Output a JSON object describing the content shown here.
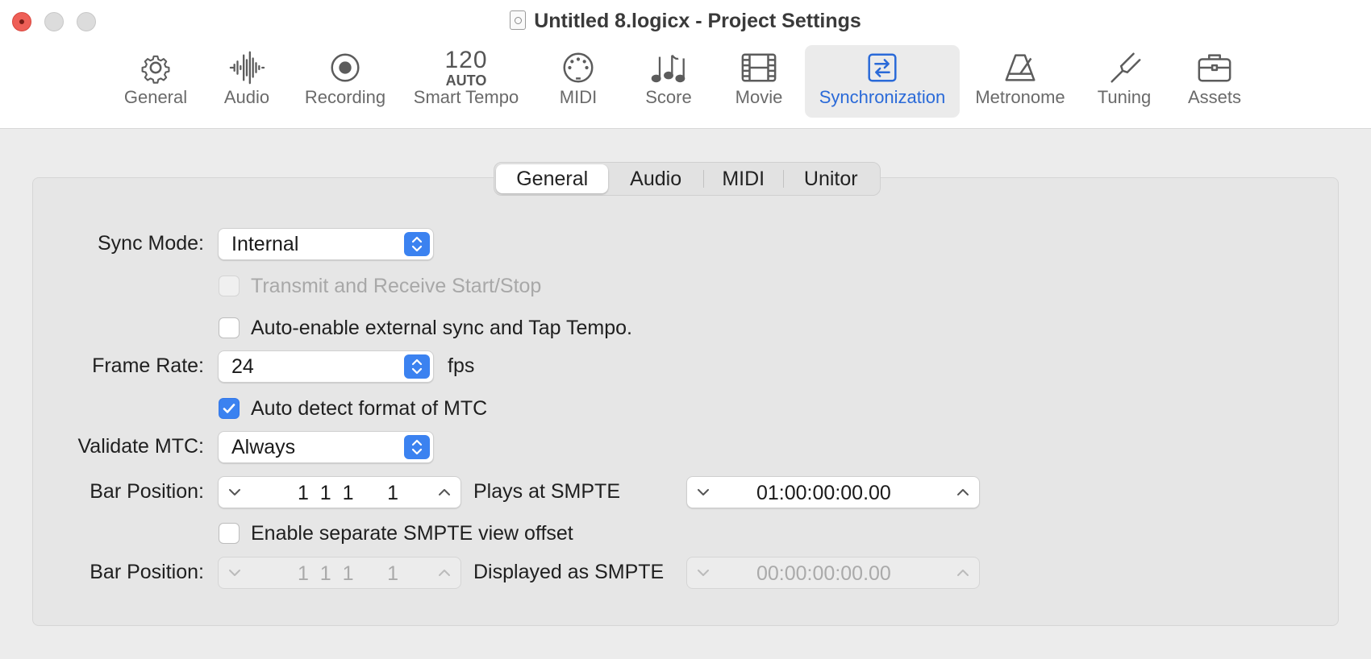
{
  "window": {
    "title": "Untitled 8.logicx - Project Settings"
  },
  "toolbar": {
    "items": [
      {
        "label": "General",
        "icon": "gear-icon"
      },
      {
        "label": "Audio",
        "icon": "waveform-icon"
      },
      {
        "label": "Recording",
        "icon": "record-icon"
      },
      {
        "label": "Smart Tempo",
        "icon": "smart-tempo-icon",
        "icon_text_top": "120",
        "icon_text_bottom": "AUTO"
      },
      {
        "label": "MIDI",
        "icon": "midi-port-icon"
      },
      {
        "label": "Score",
        "icon": "music-notes-icon"
      },
      {
        "label": "Movie",
        "icon": "film-icon"
      },
      {
        "label": "Synchronization",
        "icon": "sync-arrows-icon",
        "active": true
      },
      {
        "label": "Metronome",
        "icon": "metronome-icon"
      },
      {
        "label": "Tuning",
        "icon": "tuning-fork-icon"
      },
      {
        "label": "Assets",
        "icon": "briefcase-icon"
      }
    ],
    "active_color": "#2a6ad8"
  },
  "tabs": {
    "items": [
      "General",
      "Audio",
      "MIDI",
      "Unitor"
    ],
    "selected": "General"
  },
  "form": {
    "sync_mode": {
      "label": "Sync Mode:",
      "value": "Internal"
    },
    "transmit_receive": {
      "label": "Transmit and Receive Start/Stop",
      "checked": false,
      "enabled": false
    },
    "auto_enable": {
      "label": "Auto-enable external sync and Tap Tempo.",
      "checked": false
    },
    "frame_rate": {
      "label": "Frame Rate:",
      "value": "24",
      "unit": "fps"
    },
    "auto_detect": {
      "label": "Auto detect format of MTC",
      "checked": true
    },
    "validate_mtc": {
      "label": "Validate MTC:",
      "value": "Always"
    },
    "bar_position_1": {
      "label": "Bar Position:",
      "value": "1  1  1      1",
      "smpte_label": "Plays at SMPTE",
      "smpte_value": "01:00:00:00.00"
    },
    "separate_offset": {
      "label": "Enable separate SMPTE view offset",
      "checked": false
    },
    "bar_position_2": {
      "label": "Bar Position:",
      "value": "1  1  1      1",
      "smpte_label": "Displayed as SMPTE",
      "smpte_value": "00:00:00:00.00",
      "enabled": false
    }
  },
  "colors": {
    "accent": "#3b82f0",
    "close_button": "#ee5f57"
  }
}
